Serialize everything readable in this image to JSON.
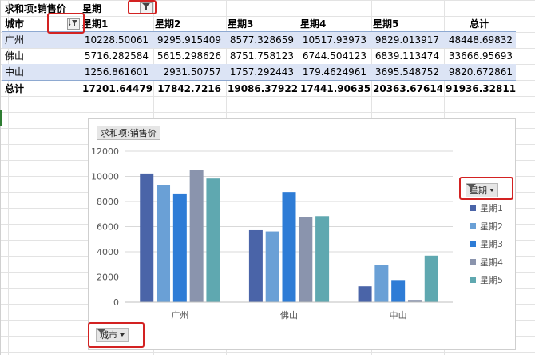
{
  "pivot": {
    "title_label": "求和项:销售价",
    "col_field": "星期",
    "row_field": "城市",
    "headers": [
      "星期1",
      "星期2",
      "星期3",
      "星期4",
      "星期5",
      "总计"
    ],
    "rows": [
      {
        "city": "广州",
        "values": [
          "10228.50061",
          "9295.915409",
          "8577.328659",
          "10517.93973",
          "9829.013917",
          "48448.69832"
        ]
      },
      {
        "city": "佛山",
        "values": [
          "5716.282584",
          "5615.298626",
          "8751.758123",
          "6744.504123",
          "6839.113474",
          "33666.95693"
        ]
      },
      {
        "city": "中山",
        "values": [
          "1256.861601",
          "2931.50757",
          "1757.292443",
          "179.4624961",
          "3695.548752",
          "9820.672861"
        ]
      }
    ],
    "total": {
      "label": "总计",
      "values": [
        "17201.64479",
        "17842.7216",
        "19086.37922",
        "17441.90635",
        "20363.67614",
        "91936.32811"
      ]
    }
  },
  "chart_panel": {
    "value_button": "求和项:销售价",
    "legend_button": "星期",
    "axis_button": "城市"
  },
  "chart_data": {
    "type": "bar",
    "categories": [
      "广州",
      "佛山",
      "中山"
    ],
    "series": [
      {
        "name": "星期1",
        "color": "#4a64a8",
        "values": [
          10228.5,
          5716.3,
          1256.9
        ]
      },
      {
        "name": "星期2",
        "color": "#6aa0d6",
        "values": [
          9295.9,
          5615.3,
          2931.5
        ]
      },
      {
        "name": "星期3",
        "color": "#2e7cd6",
        "values": [
          8577.3,
          8751.8,
          1757.3
        ]
      },
      {
        "name": "星期4",
        "color": "#8a94ad",
        "values": [
          10517.9,
          6744.5,
          179.5
        ]
      },
      {
        "name": "星期5",
        "color": "#5fa8b0",
        "values": [
          9829.0,
          6839.1,
          3695.5
        ]
      }
    ],
    "ylim": [
      0,
      12000
    ],
    "yticks": [
      "0",
      "2000",
      "4000",
      "6000",
      "8000",
      "10000",
      "12000"
    ],
    "grid": true,
    "legend_position": "right"
  }
}
